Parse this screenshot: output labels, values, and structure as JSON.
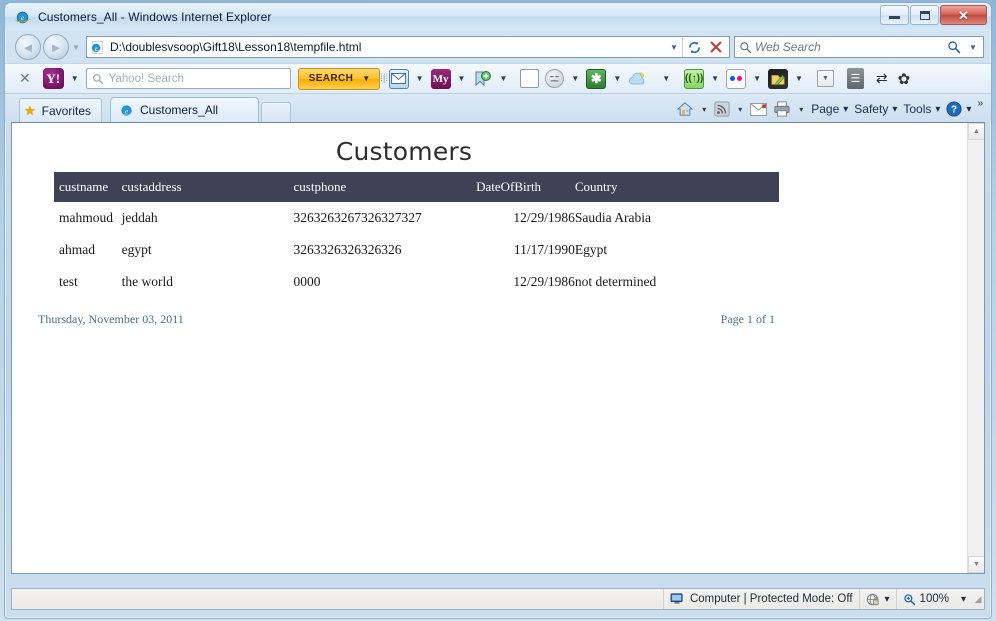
{
  "window": {
    "title": "Customers_All - Windows Internet Explorer",
    "controls": {
      "minimize": "Minimize",
      "maximize": "Restore Down",
      "close": "✕"
    }
  },
  "navbar": {
    "back_label": "◄",
    "forward_label": "►",
    "recent_pages_label": "▼",
    "url": "D:\\doublesvsoop\\Gift18\\Lesson18\\tempfile.html",
    "url_dropdown": "▼",
    "refresh_label": "↻",
    "stop_label": "✕",
    "search_placeholder": "Web Search",
    "search_dropdown": "▼"
  },
  "yahoo_toolbar": {
    "close_label": "✕",
    "logo_label": "Y!",
    "search_placeholder": "Yahoo! Search",
    "search_value": "",
    "search_button": "SEARCH",
    "dropdown_caret": "▼",
    "grip": "‖",
    "mail_icon_label": "✉",
    "my_icon_label": "My",
    "icons": [
      "yahoo-logo-icon",
      "mail-icon",
      "my-yahoo-icon",
      "bookmarks-icon",
      "blank-page-icon",
      "emoticon-icon",
      "green-star-icon",
      "weather-icon",
      "signal-icon",
      "flickr-icon",
      "notepad-icon",
      "more-icon",
      "list-icon",
      "swap-icon",
      "settings-gear-icon"
    ]
  },
  "favorites_bar": {
    "favorites_label": "Favorites",
    "star_icon": "★",
    "tab_label": "Customers_All",
    "new_tab_label": ""
  },
  "command_bar": {
    "home_icon": "🏠",
    "feeds_icon": "feeds",
    "mail_icon": "mail",
    "print_icon": "print",
    "page_label": "Page",
    "safety_label": "Safety",
    "tools_label": "Tools",
    "help_label": "?",
    "overflow_label": "»",
    "caret": "▾"
  },
  "report": {
    "title": "Customers",
    "columns": [
      "custname",
      "custaddress",
      "custphone",
      "DateOfBirth",
      "Country"
    ],
    "rows": [
      {
        "custname": "mahmoud",
        "custaddress": "jeddah",
        "custphone": "3263263267326327327",
        "DateOfBirth": "12/29/1986",
        "Country": "Saudia Arabia"
      },
      {
        "custname": "ahmad",
        "custaddress": "egypt",
        "custphone": "3263326326326326",
        "DateOfBirth": "11/17/1990",
        "Country": "Egypt"
      },
      {
        "custname": "test",
        "custaddress": "the world",
        "custphone": "0000",
        "DateOfBirth": "12/29/1986",
        "Country": "not determined"
      }
    ],
    "footer_date": "Thursday, November 03, 2011",
    "footer_page": "Page 1 of 1",
    "header_bg": "#3f4256",
    "footer_color": "#4d7081"
  },
  "scrollbar": {
    "up_arrow": "▲",
    "down_arrow": "▼"
  },
  "statusbar": {
    "left_text": "",
    "zone_text": "Computer | Protected Mode: Off",
    "zone_icon": "computer-icon",
    "zone_caret": "▾",
    "privacy_caret": "▾",
    "zoom_text": "100%",
    "zoom_caret": "▾"
  }
}
